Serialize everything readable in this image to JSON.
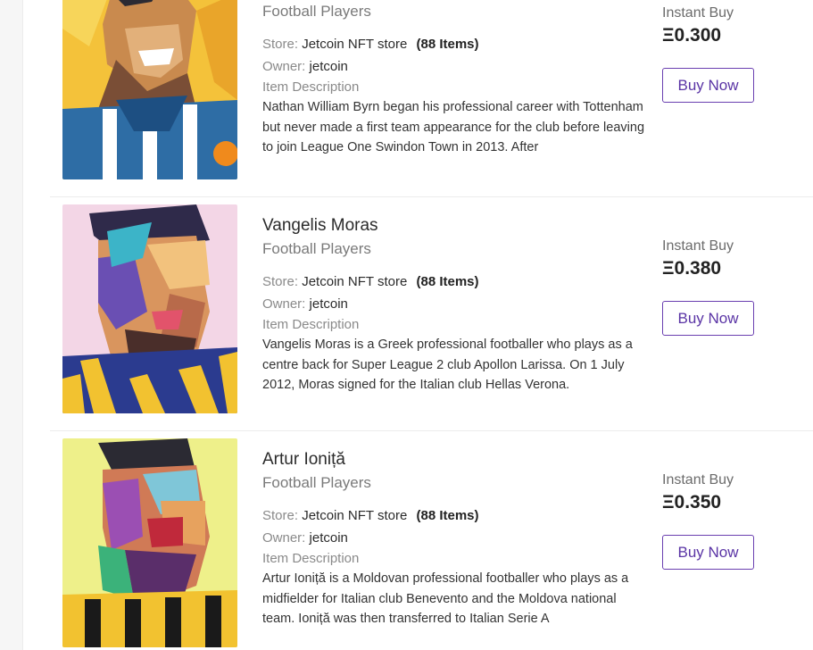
{
  "listings": [
    {
      "title": "",
      "category": "Football Players",
      "store_label": "Store:",
      "store_name": "Jetcoin NFT store",
      "store_count": "(88 Items)",
      "owner_label": "Owner:",
      "owner": "jetcoin",
      "description_label": "Item Description",
      "description": "Nathan William Byrn began his professional career with Tottenham but never made a first team appearance for the club before leaving to join League One Swindon Town in 2013. After",
      "instant_label": "Instant Buy",
      "price": "Ξ0.300",
      "buy_label": "Buy Now",
      "image_bg": "#f4c23a"
    },
    {
      "title": "Vangelis Moras",
      "category": "Football Players",
      "store_label": "Store:",
      "store_name": "Jetcoin NFT store",
      "store_count": "(88 Items)",
      "owner_label": "Owner:",
      "owner": "jetcoin",
      "description_label": "Item Description",
      "description": "Vangelis Moras is a Greek professional footballer who plays as a centre back for Super League 2 club Apollon Larissa. On 1 July 2012, Moras signed for the Italian club Hellas Verona.",
      "instant_label": "Instant Buy",
      "price": "Ξ0.380",
      "buy_label": "Buy Now",
      "image_bg": "#f3d6e6"
    },
    {
      "title": "Artur Ioniță",
      "category": "Football Players",
      "store_label": "Store:",
      "store_name": "Jetcoin NFT store",
      "store_count": "(88 Items)",
      "owner_label": "Owner:",
      "owner": "jetcoin",
      "description_label": "Item Description",
      "description": "Artur Ioniță is a Moldovan professional footballer who plays as a midfielder for Italian club Benevento and the Moldova national team. Ioniță was then transferred to Italian Serie A",
      "instant_label": "Instant Buy",
      "price": "Ξ0.350",
      "buy_label": "Buy Now",
      "image_bg": "#eef08a"
    }
  ],
  "colors": {
    "accent": "#5a34a5",
    "border": "#ececec"
  }
}
